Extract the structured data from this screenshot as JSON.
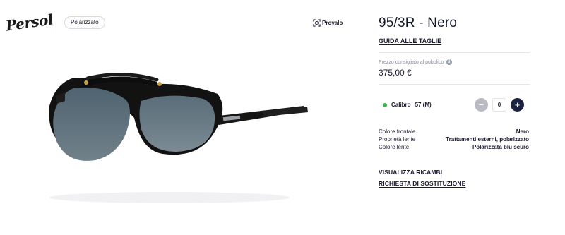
{
  "brand": {
    "logo_text": "Persol"
  },
  "badge": {
    "label": "Polarizzato"
  },
  "try_on": {
    "label": "Provalo",
    "icon": "face-scan-icon"
  },
  "product": {
    "title": "95/3R - Nero",
    "size_guide_label": "GUIDA ALLE TAGLIE",
    "price_label": "Prezzo consigliato al pubblico",
    "price": "375,00 €",
    "size_label": "Calibro",
    "size_value": "57 (M)",
    "quantity": "0",
    "availability_color": "#3cb54a"
  },
  "specs": [
    {
      "key": "Colore frontale",
      "value": "Nero"
    },
    {
      "key": "Proprietà lente",
      "value": "Trattamenti esterni, polarizzato"
    },
    {
      "key": "Colore lente",
      "value": "Polarizzata blu scuro"
    }
  ],
  "links": {
    "view_retailers": "VISUALIZZA RICAMBI",
    "replacement_request": "RICHIESTA DI SOSTITUZIONE"
  },
  "stepper": {
    "minus": "−",
    "plus": "+"
  },
  "colors": {
    "accent": "#1b2340",
    "muted": "#b9bac4"
  }
}
